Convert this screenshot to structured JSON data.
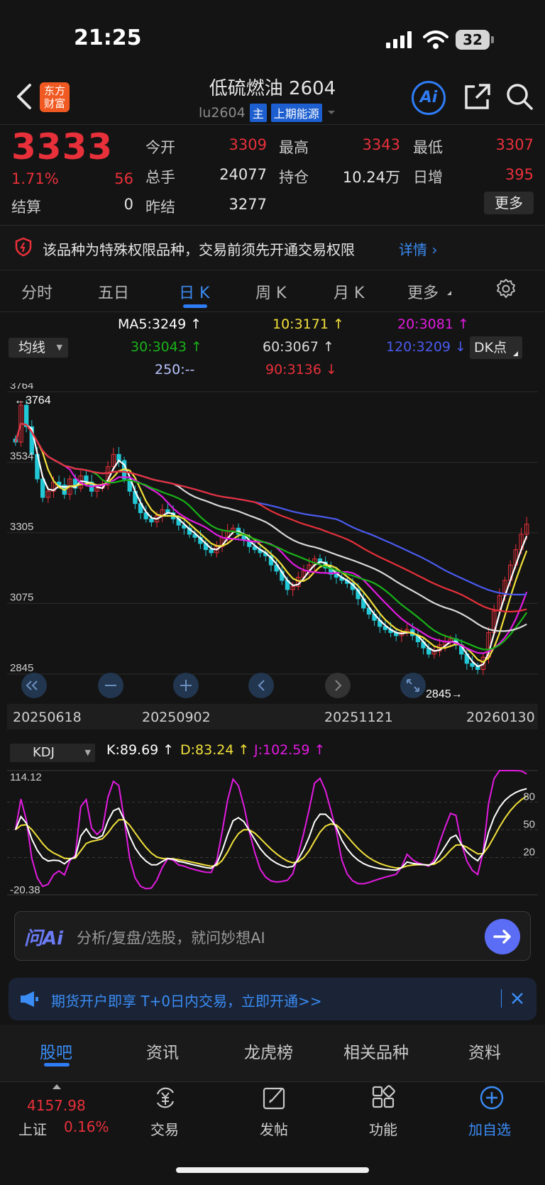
{
  "status_bar": {
    "time": "21:25",
    "battery": "32"
  },
  "header": {
    "logo_line1": "东方",
    "logo_line2": "财富",
    "title": "低硫燃油 2604",
    "code": "lu2604",
    "main_tag": "主",
    "exchange_tag": "上期能源",
    "ai_label": "Ai"
  },
  "quote": {
    "price": "3333",
    "change_pct": "1.71%",
    "change": "56",
    "settle_label": "结算",
    "settle": "0",
    "open_label": "今开",
    "open": "3309",
    "high_label": "最高",
    "high": "3343",
    "low_label": "最低",
    "low": "3307",
    "volume_label": "总手",
    "volume": "24077",
    "oi_label": "持仓",
    "oi": "10.24万",
    "day_inc_label": "日增",
    "day_inc": "395",
    "prev_settle_label": "昨结",
    "prev_settle": "3277",
    "more_label": "更多"
  },
  "notice": {
    "text": "该品种为特殊权限品种，交易前须先开通交易权限",
    "link": "详情"
  },
  "period_tabs": [
    "分时",
    "五日",
    "日 K",
    "周 K",
    "月 K",
    "更多"
  ],
  "active_period": "日 K",
  "ma_legend": {
    "select_label": "均线",
    "dk_label": "DK点",
    "items": [
      {
        "label": "MA5:3249 ↑",
        "color": "#ffffff"
      },
      {
        "label": "10:3171 ↑",
        "color": "#f2e03a"
      },
      {
        "label": "20:3081 ↑",
        "color": "#e21be0"
      },
      {
        "label": "30:3043 ↑",
        "color": "#19b219"
      },
      {
        "label": "60:3067 ↑",
        "color": "#d9d9d9"
      },
      {
        "label": "120:3209 ↓",
        "color": "#4a5bf0"
      },
      {
        "label": "250:--",
        "color": "#b9c4ff"
      },
      {
        "label": "90:3136 ↓",
        "color": "#e8303a"
      }
    ]
  },
  "chart_data": [
    {
      "type": "candlestick",
      "y_ticks": [
        "3764",
        "3534",
        "3305",
        "3075",
        "2845"
      ],
      "ylim": [
        2845,
        3764
      ],
      "x_labels": [
        "20250618",
        "20250902",
        "20251121",
        "20260130"
      ],
      "high_marker": "←3764",
      "low_marker": "2845→",
      "close_series": [
        3600,
        3720,
        3650,
        3560,
        3480,
        3420,
        3440,
        3470,
        3460,
        3430,
        3480,
        3450,
        3490,
        3470,
        3440,
        3450,
        3460,
        3520,
        3560,
        3540,
        3480,
        3440,
        3400,
        3370,
        3350,
        3340,
        3360,
        3380,
        3370,
        3350,
        3330,
        3320,
        3300,
        3290,
        3270,
        3250,
        3240,
        3260,
        3290,
        3310,
        3320,
        3300,
        3280,
        3260,
        3250,
        3240,
        3230,
        3200,
        3180,
        3150,
        3120,
        3130,
        3160,
        3180,
        3200,
        3220,
        3210,
        3190,
        3170,
        3160,
        3150,
        3140,
        3120,
        3090,
        3060,
        3040,
        3020,
        3000,
        2990,
        2980,
        2970,
        2980,
        2990,
        2970,
        2950,
        2930,
        2910,
        2920,
        2940,
        2950,
        2960,
        2940,
        2910,
        2880,
        2870,
        2860,
        2900,
        2980,
        3050,
        3100,
        3150,
        3200,
        3250,
        3300,
        3333
      ],
      "series": [
        {
          "name": "MA5",
          "color": "#ffffff"
        },
        {
          "name": "MA10",
          "color": "#f2e03a"
        },
        {
          "name": "MA20",
          "color": "#e21be0"
        },
        {
          "name": "MA30",
          "color": "#19b219"
        },
        {
          "name": "MA60",
          "color": "#d9d9d9"
        },
        {
          "name": "MA120",
          "color": "#4a5bf0"
        },
        {
          "name": "MA90",
          "color": "#e8303a"
        }
      ]
    },
    {
      "type": "line",
      "indicator": "KDJ",
      "y_ticks": [
        "114.12",
        "80",
        "50",
        "20",
        "-20.38"
      ],
      "ylim": [
        -20.38,
        114.12
      ],
      "series": [
        {
          "name": "K:89.69 ↑",
          "color": "#ffffff"
        },
        {
          "name": "D:83.24 ↑",
          "color": "#f2e03a"
        },
        {
          "name": "J:102.59 ↑",
          "color": "#e21be0"
        }
      ]
    }
  ],
  "kdj_select_label": "KDJ",
  "ai_box": {
    "logo": "问Ai",
    "placeholder": "分析/复盘/选股，就问妙想AI"
  },
  "promo": {
    "text": "期货开户即享 T+0日内交易，立即开通>>"
  },
  "bottom_tabs": [
    "股吧",
    "资讯",
    "龙虎榜",
    "相关品种",
    "资料"
  ],
  "bottom_nav": {
    "index_value": "4157.98",
    "index_name": "上证",
    "index_change": "0.16%",
    "items": [
      "交易",
      "发帖",
      "功能",
      "加自选"
    ]
  }
}
